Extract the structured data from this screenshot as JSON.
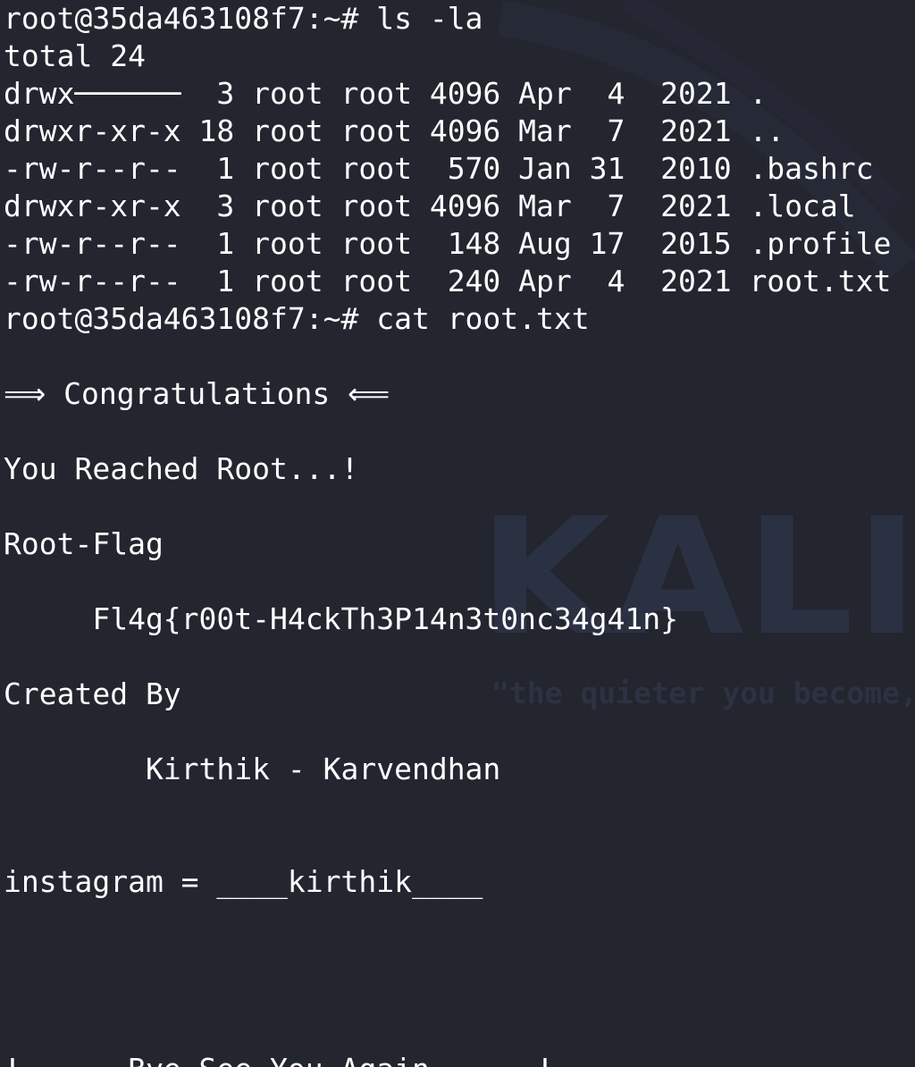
{
  "wallpaper": {
    "logo_text": "KALI",
    "tagline": "\"the quieter you become,"
  },
  "terminal": {
    "lines": [
      "root@35da463108f7:~# ls -la",
      "total 24",
      "drwx──────  3 root root 4096 Apr  4  2021 .",
      "drwxr-xr-x 18 root root 4096 Mar  7  2021 ..",
      "-rw-r--r--  1 root root  570 Jan 31  2010 .bashrc",
      "drwxr-xr-x  3 root root 4096 Mar  7  2021 .local",
      "-rw-r--r--  1 root root  148 Aug 17  2015 .profile",
      "-rw-r--r--  1 root root  240 Apr  4  2021 root.txt",
      "root@35da463108f7:~# cat root.txt",
      "",
      "⟹ Congratulations ⟸",
      "",
      "You Reached Root...!",
      "",
      "Root-Flag",
      "",
      "     Fl4g{r00t-H4ckTh3P14n3t0nc34g41n}",
      "",
      "Created By",
      "",
      "        Kirthik - Karvendhan",
      "",
      "",
      "instagram = ____kirthik____",
      "",
      "",
      "",
      "",
      "!......Bye See You Again......!"
    ]
  },
  "colors": {
    "background": "#23252f",
    "foreground": "#ffffff",
    "wallpaper_art": "#2a3143"
  }
}
